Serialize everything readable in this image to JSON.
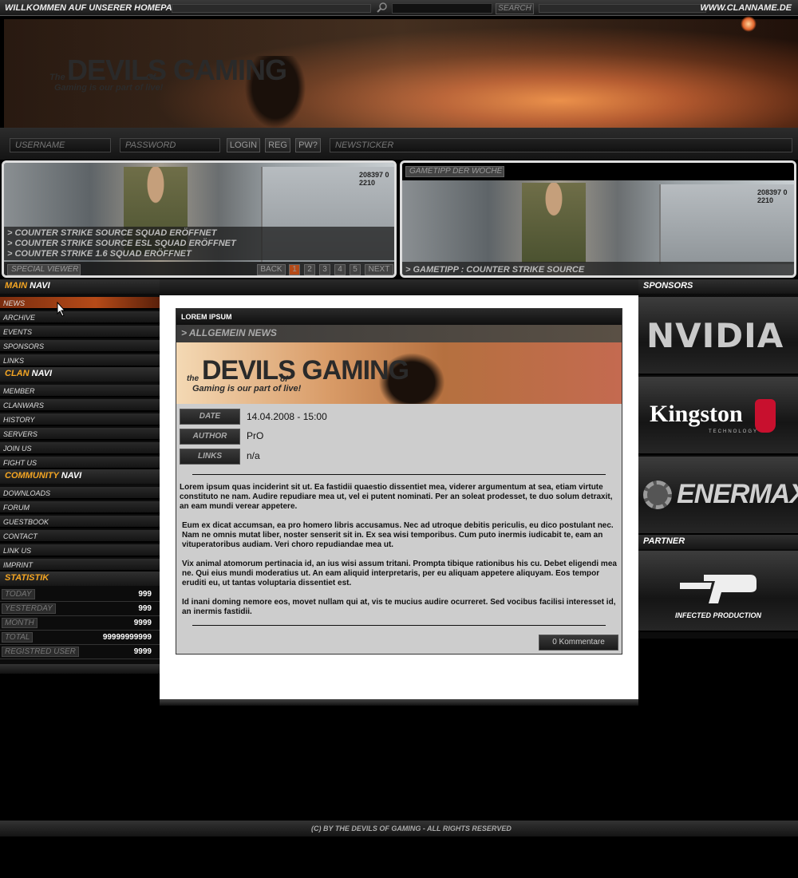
{
  "topbar": {
    "welcome": "WILLKOMMEN AUF UNSERER HOMEPAGE",
    "search_button": "SEARCH",
    "site_url": "WWW.CLANNAME.DE"
  },
  "header": {
    "logo_the": "The",
    "logo_main": "DEVILS GAMING",
    "logo_of": "Of",
    "tagline": "Gaming is our part of live!"
  },
  "loginbar": {
    "username_placeholder": "USERNAME",
    "password_placeholder": "PASSWORD",
    "login": "LOGIN",
    "reg": "REG",
    "pw": "PW?",
    "newsticker": "NEWSTICKER"
  },
  "special_viewer": {
    "news": [
      "> COUNTER STRIKE SOURCE SQUAD ERÖFFNET",
      "> COUNTER STRIKE SOURCE ESL SQUAD ERÖFFNET",
      "> COUNTER STRIKE 1.6 SQUAD ERÖFFNET"
    ],
    "label": "SPECIAL VIEWER",
    "back": "BACK",
    "pages": [
      "1",
      "2",
      "3",
      "4",
      "5"
    ],
    "next": "NEXT",
    "container_text": "208397 0\n2210"
  },
  "gametipp": {
    "title": "GAMETIPP DER WOCHE",
    "caption": "> GAMETIPP : COUNTER STRIKE SOURCE",
    "container_text": "208397 0\n2210"
  },
  "leftnav": {
    "main_navi": {
      "a": "MAIN",
      "b": "NAVI"
    },
    "main_items": [
      "NEWS",
      "ARCHIVE",
      "EVENTS",
      "SPONSORS",
      "LINKS"
    ],
    "clan_navi": {
      "a": "CLAN",
      "b": "NAVI"
    },
    "clan_items": [
      "MEMBER",
      "CLANWARS",
      "HISTORY",
      "SERVERS",
      "JOIN US",
      "FIGHT US"
    ],
    "community_navi": {
      "a": "COMMUNITY",
      "b": "NAVI"
    },
    "community_items": [
      "DOWNLOADS",
      "FORUM",
      "GUESTBOOK",
      "CONTACT",
      "LINK US",
      "IMPRINT"
    ],
    "statistik": "STATISTIK",
    "stats": [
      {
        "label": "TODAY",
        "value": "999"
      },
      {
        "label": "YESTERDAY",
        "value": "999"
      },
      {
        "label": "MONTH",
        "value": "9999"
      },
      {
        "label": "TOTAL",
        "value": "99999999999"
      },
      {
        "label": "REGISTRED USER",
        "value": "9999"
      }
    ]
  },
  "article": {
    "box_title": "LOREM IPSUM",
    "subtitle": "> ALLGEMEIN NEWS",
    "banner_the": "the",
    "banner_main": "DEVILS GAMING",
    "banner_of": "of",
    "banner_tagline": "Gaming is our part of live!",
    "date_label": "DATE",
    "date_value": "14.04.2008 - 15:00",
    "author_label": "AUTHOR",
    "author_value": "PrO",
    "links_label": "LINKS",
    "links_value": "n/a",
    "paragraphs": [
      "Lorem ipsum quas inciderint sit ut. Ea fastidii quaestio dissentiet mea, viderer argumentum at sea, etiam virtute constituto ne nam. Audire repudiare mea ut, vel ei putent nominati. Per an soleat prodesset, te duo solum detraxit, an eam mundi verear appetere.",
      "Eum ex dicat accumsan, ea pro homero libris accusamus. Nec ad utroque debitis periculis, eu dico postulant nec. Nam ne omnis mutat liber, noster senserit sit in. Ex sea wisi temporibus. Cum puto inermis iudicabit te, eam an vituperatoribus audiam. Veri choro repudiandae mea ut.",
      "Vix animal atomorum pertinacia id, an ius wisi assum tritani. Prompta tibique rationibus his cu. Debet eligendi mea ne. Qui eius mundi moderatius ut. An eam aliquid interpretaris, per eu aliquam appetere aliquyam. Eos tempor eruditi eu, ut tantas voluptaria dissentiet est.",
      "Id inani doming nemore eos, movet nullam qui at, vis te mucius audire ocurreret. Sed vocibus facilisi interesset id, an inermis fastidii."
    ],
    "comments_button": "0 Kommentare"
  },
  "rightcol": {
    "sponsors_title": "SPONSORS",
    "sponsors": [
      "NVIDIA",
      "Kingston",
      "ENERMAX"
    ],
    "kingston_sub": "TECHNOLOGY",
    "partner_title": "PARTNER",
    "partner_name": "INFECTED PRODUCTION"
  },
  "footer": {
    "copyright": "(C) BY THE DEVILS OF GAMING - ALL RIGHTS RESERVED"
  },
  "colors": {
    "accent": "#f5a623",
    "active_nav": "#b54a18"
  }
}
